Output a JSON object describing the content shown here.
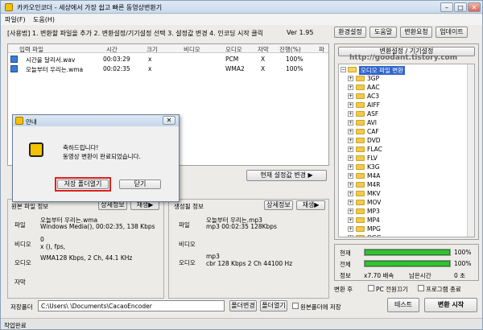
{
  "app": {
    "title": "카카오인코더 - 세상에서 가장 쉽고 빠른 동영상변환기"
  },
  "menu": [
    "파일(F)",
    "도움(H)"
  ],
  "steps": {
    "text": "[사용법] 1. 변환할 파일을 추가  2. 변환설정/기기설정 선택  3. 설정값 변경  4. 인코딩 시작 클릭",
    "version": "Ver 1.95"
  },
  "topbuttons": [
    "환경설정",
    "도움말",
    "변환요청",
    "업데이트"
  ],
  "filelist": {
    "headers": [
      "입력 파일",
      "시간",
      "크기",
      "비디오",
      "오디오",
      "자막",
      "진행(%)",
      "파"
    ],
    "rows": [
      {
        "name": "시간을 달리서.wav",
        "time": "00:03:29",
        "size": "x",
        "video": "",
        "audio": "PCM",
        "sub": "X",
        "progress": "100%"
      },
      {
        "name": "오늘부터 우리는.wma",
        "time": "00:02:35",
        "size": "x",
        "video": "",
        "audio": "WMA2",
        "sub": "X",
        "progress": "100%"
      }
    ]
  },
  "current_settings_btn": "현재 설정값 변경 ▶",
  "source_info": {
    "title": "원본 파일 정보",
    "btn1": "상세정보",
    "btn2": "재생▶",
    "file_label": "파일",
    "file_val1": "오늘부터 우리는.wma",
    "file_val2": "Windows Media(), 00:02:35, 138 Kbps",
    "video_label": "비디오",
    "video_val1": "0",
    "video_val2": "x (), fps,",
    "audio_label": "오디오",
    "audio_val": "WMA128 Kbps, 2 Ch, 44.1 KHz",
    "sub_label": "자막"
  },
  "output_info": {
    "title": "생성될 정보",
    "btn1": "상세정보",
    "btn2": "재생▶",
    "file_label": "파일",
    "file_val1": "오늘부터 우리는.mp3",
    "file_val2": "mp3  00:02:35  128Kbps",
    "video_label": "비디오",
    "audio_label": "오디오",
    "audio_val1": "mp3",
    "audio_val2": "cbr    128 Kbps  2 Ch  44100 Hz"
  },
  "convert_settings": {
    "title": "변환설정 / 기기설정",
    "url": "http://goodant.tistory.com",
    "root": "오디오 파일 변환",
    "items": [
      "3GP",
      "AAC",
      "AC3",
      "AIFF",
      "ASF",
      "AVI",
      "CAF",
      "DVD",
      "FLAC",
      "FLV",
      "K3G",
      "M4A",
      "M4R",
      "MKV",
      "MOV",
      "MP3",
      "MP4",
      "MPG",
      "OGG"
    ]
  },
  "progress": {
    "current_label": "현재",
    "current_val": "100%",
    "current_level": 1.0,
    "total_label": "전체",
    "total_val": "100%",
    "total_level": 1.0,
    "info_label": "정보",
    "speed": "x7.70 배속",
    "remain_label": "남은시간",
    "remain_val": "0 초"
  },
  "after": {
    "label": "변환 후",
    "pc_shutdown": "PC 전원끄기",
    "prog_exit": "프로그램 종료"
  },
  "save": {
    "label": "저장폴더",
    "path": "C:\\Users\\        \\Documents\\CacaoEncoder",
    "change_btn": "폴더변경",
    "open_btn": "폴더열기",
    "same_folder": "원본폴더에 저장"
  },
  "test_btn": "테스트",
  "start_btn": "변환 시작",
  "status": "작업완료",
  "dialog": {
    "title": "안내",
    "line1": "축하드립니다!",
    "line2": "동영상 변환이 완료되었습니다.",
    "open_folder": "저장 폴더열기",
    "close": "닫기"
  }
}
